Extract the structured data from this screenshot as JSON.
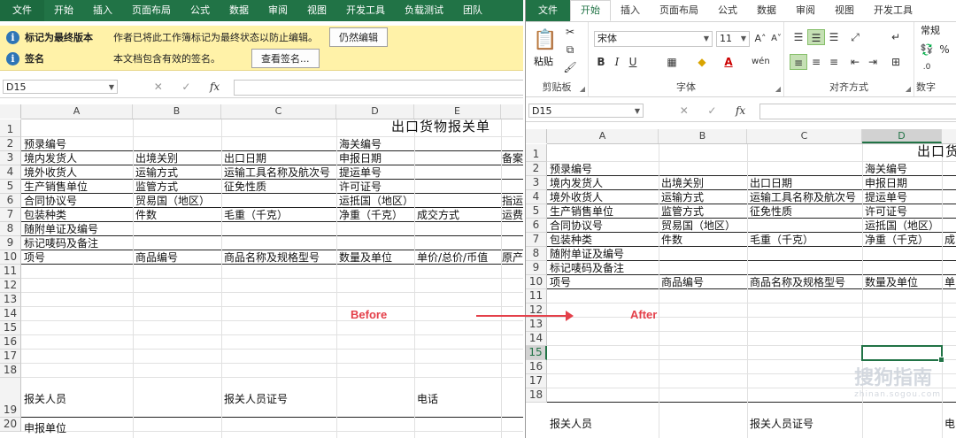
{
  "left": {
    "tabs": [
      "文件",
      "开始",
      "插入",
      "页面布局",
      "公式",
      "数据",
      "审阅",
      "视图",
      "开发工具",
      "负载测试",
      "团队"
    ],
    "messages": [
      {
        "title": "标记为最终版本",
        "text": "作者已将此工作簿标记为最终状态以防止编辑。",
        "button": "仍然编辑"
      },
      {
        "title": "签名",
        "text": "本文档包含有效的签名。",
        "button": "查看签名..."
      }
    ],
    "name_box": "D15",
    "columns": [
      "A",
      "B",
      "C",
      "D",
      "E"
    ],
    "rows": [
      "1",
      "2",
      "3",
      "4",
      "5",
      "6",
      "7",
      "8",
      "9",
      "10",
      "11",
      "12",
      "13",
      "14",
      "15",
      "16",
      "17",
      "18",
      "19",
      "20"
    ],
    "cells": {
      "title": "出口货物报关单",
      "r2": [
        "预录编号",
        "海关编号"
      ],
      "r3": [
        "境内发货人",
        "出境关别",
        "出口日期",
        "申报日期",
        "备案"
      ],
      "r4": [
        "境外收货人",
        "运输方式",
        "运输工具名称及航次号",
        "提运单号"
      ],
      "r5": [
        "生产销售单位",
        "监管方式",
        "征免性质",
        "许可证号"
      ],
      "r6": [
        "合同协议号",
        "贸易国（地区）",
        "运抵国（地区）",
        "指运"
      ],
      "r7": [
        "包装种类",
        "件数",
        "毛重（千克）",
        "净重（千克）",
        "成交方式",
        "运费"
      ],
      "r8": "随附单证及编号",
      "r9": "标记唛码及备注",
      "r10": [
        "项号",
        "商品编号",
        "商品名称及规格型号",
        "数量及单位",
        "单价/总价/币值",
        "原产"
      ],
      "r19": [
        "报关人员",
        "报关人员证号",
        "电话"
      ],
      "r20": "申报单位"
    }
  },
  "right": {
    "tabs": [
      "文件",
      "开始",
      "插入",
      "页面布局",
      "公式",
      "数据",
      "审阅",
      "视图",
      "开发工具"
    ],
    "ribbon": {
      "clipboard_label": "剪贴板",
      "paste_label": "粘贴",
      "font_label": "字体",
      "font_name": "宋体",
      "font_size": "11",
      "align_label": "对齐方式",
      "number_label": "数字",
      "number_format": "常规"
    },
    "name_box": "D15",
    "columns": [
      "A",
      "B",
      "C",
      "D"
    ],
    "rows": [
      "1",
      "2",
      "3",
      "4",
      "5",
      "6",
      "7",
      "8",
      "9",
      "10",
      "11",
      "12",
      "13",
      "14",
      "15",
      "16",
      "17",
      "18"
    ],
    "cells": {
      "title": "出口货",
      "r2": [
        "预录编号",
        "海关编号"
      ],
      "r3": [
        "境内发货人",
        "出境关别",
        "出口日期",
        "申报日期"
      ],
      "r4": [
        "境外收货人",
        "运输方式",
        "运输工具名称及航次号",
        "提运单号"
      ],
      "r5": [
        "生产销售单位",
        "监管方式",
        "征免性质",
        "许可证号"
      ],
      "r6": [
        "合同协议号",
        "贸易国（地区）",
        "运抵国（地区）"
      ],
      "r7": [
        "包装种类",
        "件数",
        "毛重（千克）",
        "净重（千克）",
        "成"
      ],
      "r8": "随附单证及编号",
      "r9": "标记唛码及备注",
      "r10": [
        "项号",
        "商品编号",
        "商品名称及规格型号",
        "数量及单位",
        "单"
      ],
      "r19": [
        "报关人员",
        "报关人员证号",
        "电"
      ]
    }
  },
  "annotations": {
    "before": "Before",
    "after": "After"
  },
  "watermark": {
    "main": "搜狗指南",
    "sub": "zhinan.sogou.com"
  }
}
